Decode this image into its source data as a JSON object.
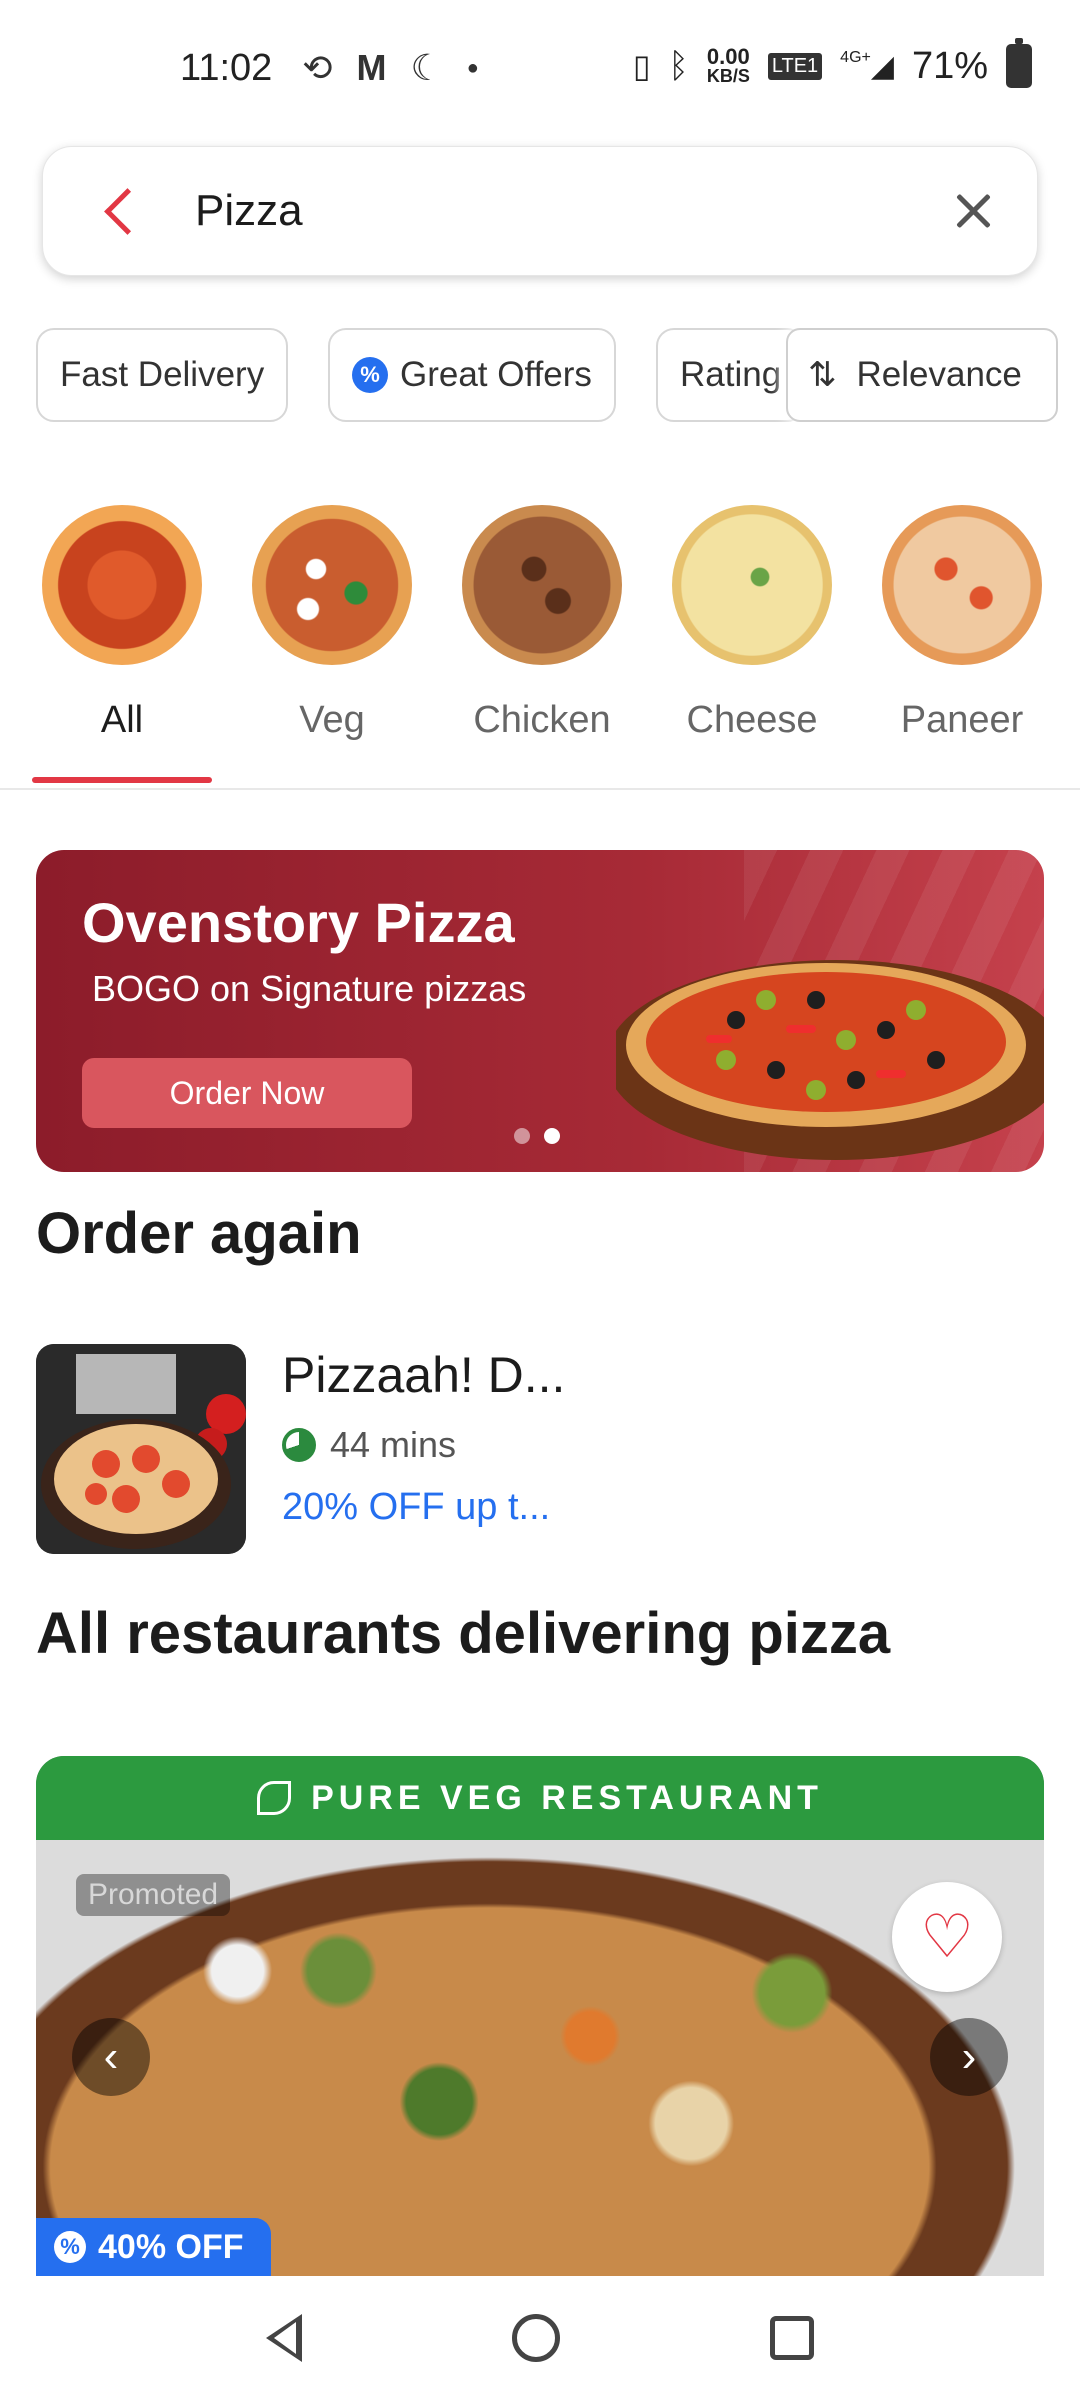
{
  "status_bar": {
    "time": "11:02",
    "net_speed": "0.00",
    "net_unit": "KB/S",
    "network": "4G+",
    "battery": "71%"
  },
  "search": {
    "value": "Pizza",
    "placeholder": "Search"
  },
  "filters": [
    {
      "label": "Fast Delivery"
    },
    {
      "label": "Great Offers"
    },
    {
      "label": "Rating"
    }
  ],
  "sort": {
    "label": "Relevance"
  },
  "categories": [
    {
      "label": "All",
      "active": true
    },
    {
      "label": "Veg"
    },
    {
      "label": "Chicken"
    },
    {
      "label": "Cheese"
    },
    {
      "label": "Paneer"
    }
  ],
  "banner": {
    "title": "Ovenstory Pizza",
    "subtitle": "BOGO on Signature pizzas",
    "button": "Order Now",
    "slide_count": 2,
    "active_slide": 2
  },
  "order_again": {
    "heading": "Order again",
    "item": {
      "name": "Pizzaah! D...",
      "time": "44 mins",
      "offer": "20% OFF up t..."
    }
  },
  "restaurants": {
    "heading": "All restaurants delivering pizza",
    "card": {
      "tag": "PURE VEG RESTAURANT",
      "promoted": "Promoted",
      "discount": "40% OFF"
    }
  },
  "colors": {
    "accent": "#e23744",
    "offer_blue": "#256fef",
    "veg_green": "#2c9a3f"
  }
}
